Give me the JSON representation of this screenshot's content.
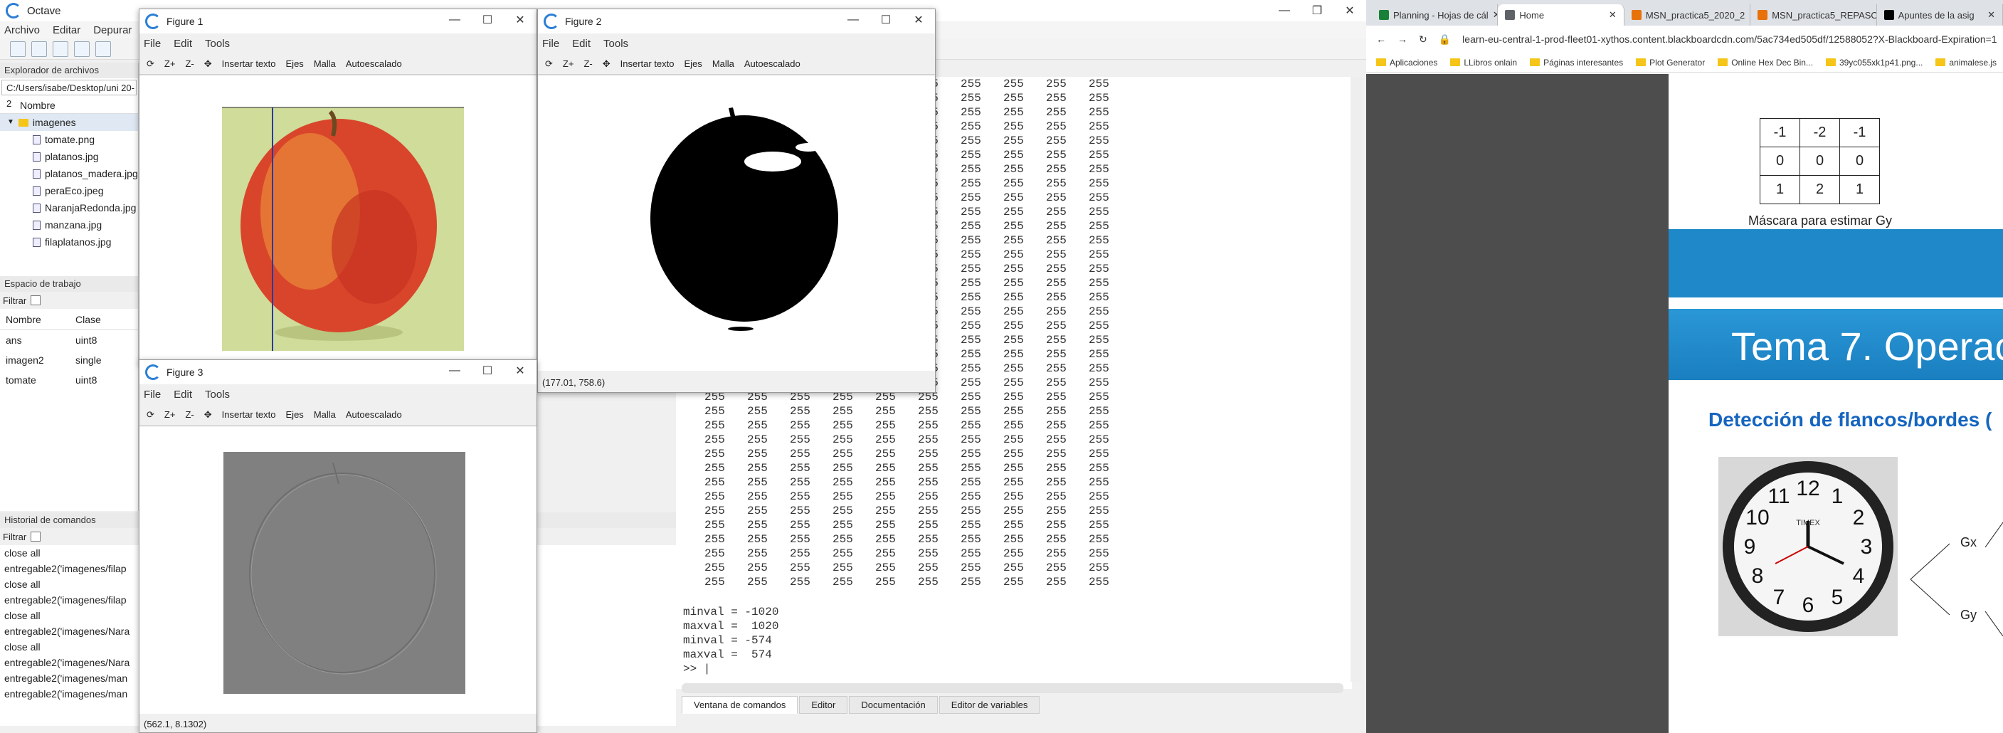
{
  "octave": {
    "title": "Octave",
    "menu": [
      "Archivo",
      "Editar",
      "Depurar"
    ],
    "path": "C:/Users/isabe/Desktop/uni 20-2",
    "file_browser": {
      "header": "Explorador de archivos",
      "col_name": "Nombre",
      "folder": "imagenes",
      "files": [
        "tomate.png",
        "platanos.jpg",
        "platanos_madera.jpg",
        "peraEco.jpeg",
        "NaranjaRedonda.jpg",
        "manzana.jpg",
        "filaplatanos.jpg"
      ]
    },
    "workspace": {
      "header": "Espacio de trabajo",
      "filter": "Filtrar",
      "col_name": "Nombre",
      "col_class": "Clase",
      "rows": [
        {
          "name": "ans",
          "cls": "uint8"
        },
        {
          "name": "imagen2",
          "cls": "single"
        },
        {
          "name": "tomate",
          "cls": "uint8"
        }
      ]
    },
    "history": {
      "header": "Historial de comandos",
      "filter": "Filtrar",
      "items": [
        "close all",
        "entregable2('imagenes/filap",
        "close all",
        "entregable2('imagenes/filap",
        "close all",
        "entregable2('imagenes/Nara",
        "close all",
        "entregable2('imagenes/Nara",
        "entregable2('imagenes/man",
        "entregable2('imagenes/man"
      ]
    },
    "console": {
      "value": "255",
      "output": [
        "minval = -1020",
        "maxval =  1020",
        "minval = -574",
        "maxval =  574",
        ">> |"
      ]
    },
    "tabs": [
      "Ventana de comandos",
      "Editor",
      "Documentación",
      "Editor de variables"
    ]
  },
  "figures": [
    {
      "title": "Figure 1",
      "menu": [
        "File",
        "Edit",
        "Tools"
      ],
      "tools": [
        "Z+",
        "Z-",
        "Insertar texto",
        "Ejes",
        "Malla",
        "Autoescalado"
      ]
    },
    {
      "title": "Figure 2",
      "menu": [
        "File",
        "Edit",
        "Tools"
      ],
      "tools": [
        "Z+",
        "Z-",
        "Insertar texto",
        "Ejes",
        "Malla",
        "Autoescalado"
      ],
      "status": "(177.01, 758.6)"
    },
    {
      "title": "Figure 3",
      "menu": [
        "File",
        "Edit",
        "Tools"
      ],
      "tools": [
        "Z+",
        "Z-",
        "Insertar texto",
        "Ejes",
        "Malla",
        "Autoescalado"
      ],
      "status": "(562.1, 8.1302)"
    }
  ],
  "browser": {
    "tabs": [
      {
        "label": "Planning - Hojas de cál",
        "color": "#188038"
      },
      {
        "label": "Home",
        "color": "#5f6368"
      },
      {
        "label": "MSN_practica5_2020_2",
        "color": "#e8710a"
      },
      {
        "label": "MSN_practica5_REPASO",
        "color": "#e8710a"
      },
      {
        "label": "Apuntes de la asig",
        "color": "#000000"
      }
    ],
    "url": "learn-eu-central-1-prod-fleet01-xythos.content.blackboardcdn.com/5ac734ed505df/12588052?X-Blackboard-Expiration=1",
    "bookmarks": [
      "Aplicaciones",
      "LLibros onlain",
      "Páginas interesantes",
      "Plot Generator",
      "Online Hex Dec Bin...",
      "39yc055xk1p41.png...",
      "animalese.js"
    ]
  },
  "slide": {
    "mask": [
      [
        "-1",
        "-2",
        "-1"
      ],
      [
        "0",
        "0",
        "0"
      ],
      [
        "1",
        "2",
        "1"
      ]
    ],
    "mask_caption": "Máscara para estimar Gy",
    "title": "Tema 7. Operac",
    "subtitle": "Detección de flancos/bordes (",
    "gx": "Gx",
    "gy": "Gy",
    "brand": "TIMEX",
    "clock_numbers": [
      "12",
      "1",
      "2",
      "3",
      "4",
      "5",
      "6",
      "7",
      "8",
      "9",
      "10",
      "11"
    ]
  },
  "colors": {
    "accent": "#1565c0",
    "blue_band": "#1e88c8",
    "apple_bg": "#cfdc9a"
  }
}
